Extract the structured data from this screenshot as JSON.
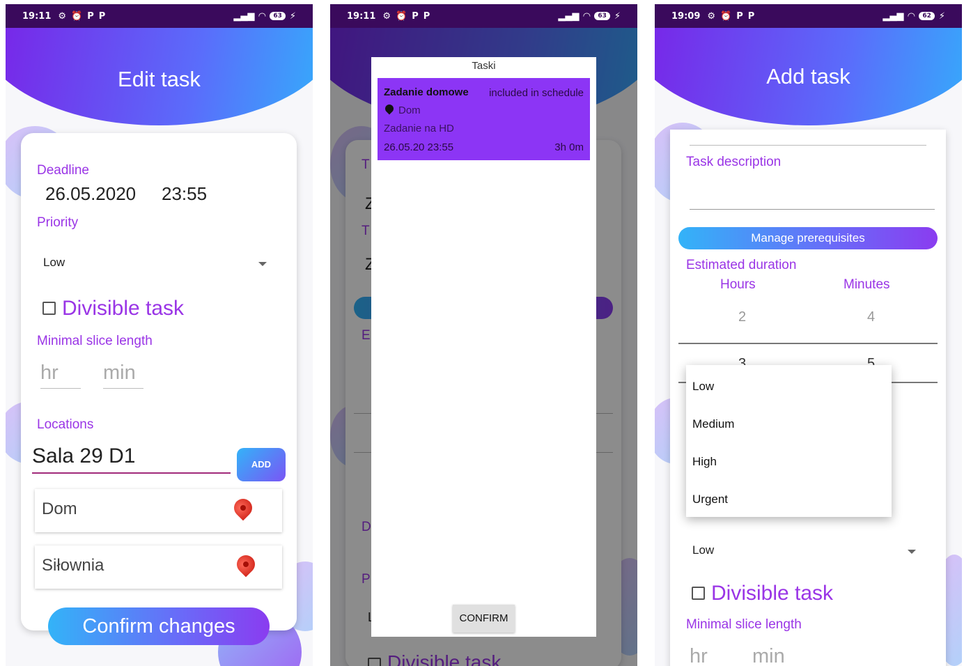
{
  "status_bars": [
    {
      "time": "19:11",
      "battery": "63"
    },
    {
      "time": "19:11",
      "battery": "63"
    },
    {
      "time": "19:09",
      "battery": "62"
    }
  ],
  "edit": {
    "title": "Edit task",
    "deadline_label": "Deadline",
    "deadline_date": "26.05.2020",
    "deadline_time": "23:55",
    "priority_label": "Priority",
    "priority_value": "Low",
    "divisible_label": "Divisible task",
    "min_slice_label": "Minimal slice length",
    "hr_placeholder": "hr",
    "min_placeholder": "min",
    "locations_label": "Locations",
    "location_input": "Sala 29 D1",
    "add_button": "ADD",
    "locations": [
      "Dom",
      "Siłownia"
    ],
    "confirm_button": "Confirm changes"
  },
  "dialog": {
    "title": "Taski",
    "background_letters": [
      "T",
      "Z",
      "T",
      "Z",
      "E",
      "D",
      "P",
      "L"
    ],
    "background_divisible": "Divisible task",
    "task": {
      "name": "Zadanie domowe",
      "status": "included in schedule",
      "location": "Dom",
      "description": "Zadanie na HD",
      "date": "26.05.20 23:55",
      "duration": "3h 0m"
    },
    "confirm_button": "CONFIRM"
  },
  "add": {
    "title": "Add task",
    "description_label": "Task description",
    "prerequisites_button": "Manage prerequisites",
    "duration_label": "Estimated duration",
    "hours_label": "Hours",
    "minutes_label": "Minutes",
    "hours_values": [
      "2",
      "3"
    ],
    "minutes_values": [
      "4",
      "5"
    ],
    "priority_options": [
      "Low",
      "Medium",
      "High",
      "Urgent"
    ],
    "priority_value": "Low",
    "divisible_label": "Divisible task",
    "min_slice_label": "Minimal slice length",
    "hr_placeholder": "hr",
    "min_placeholder": "min"
  },
  "colors": {
    "accent_purple": "#9a35e6",
    "gradient_blue": "#33b3f8",
    "gradient_violet": "#8a3cf0",
    "task_card": "#8c35f5",
    "status_bar": "#3a0a5c"
  }
}
